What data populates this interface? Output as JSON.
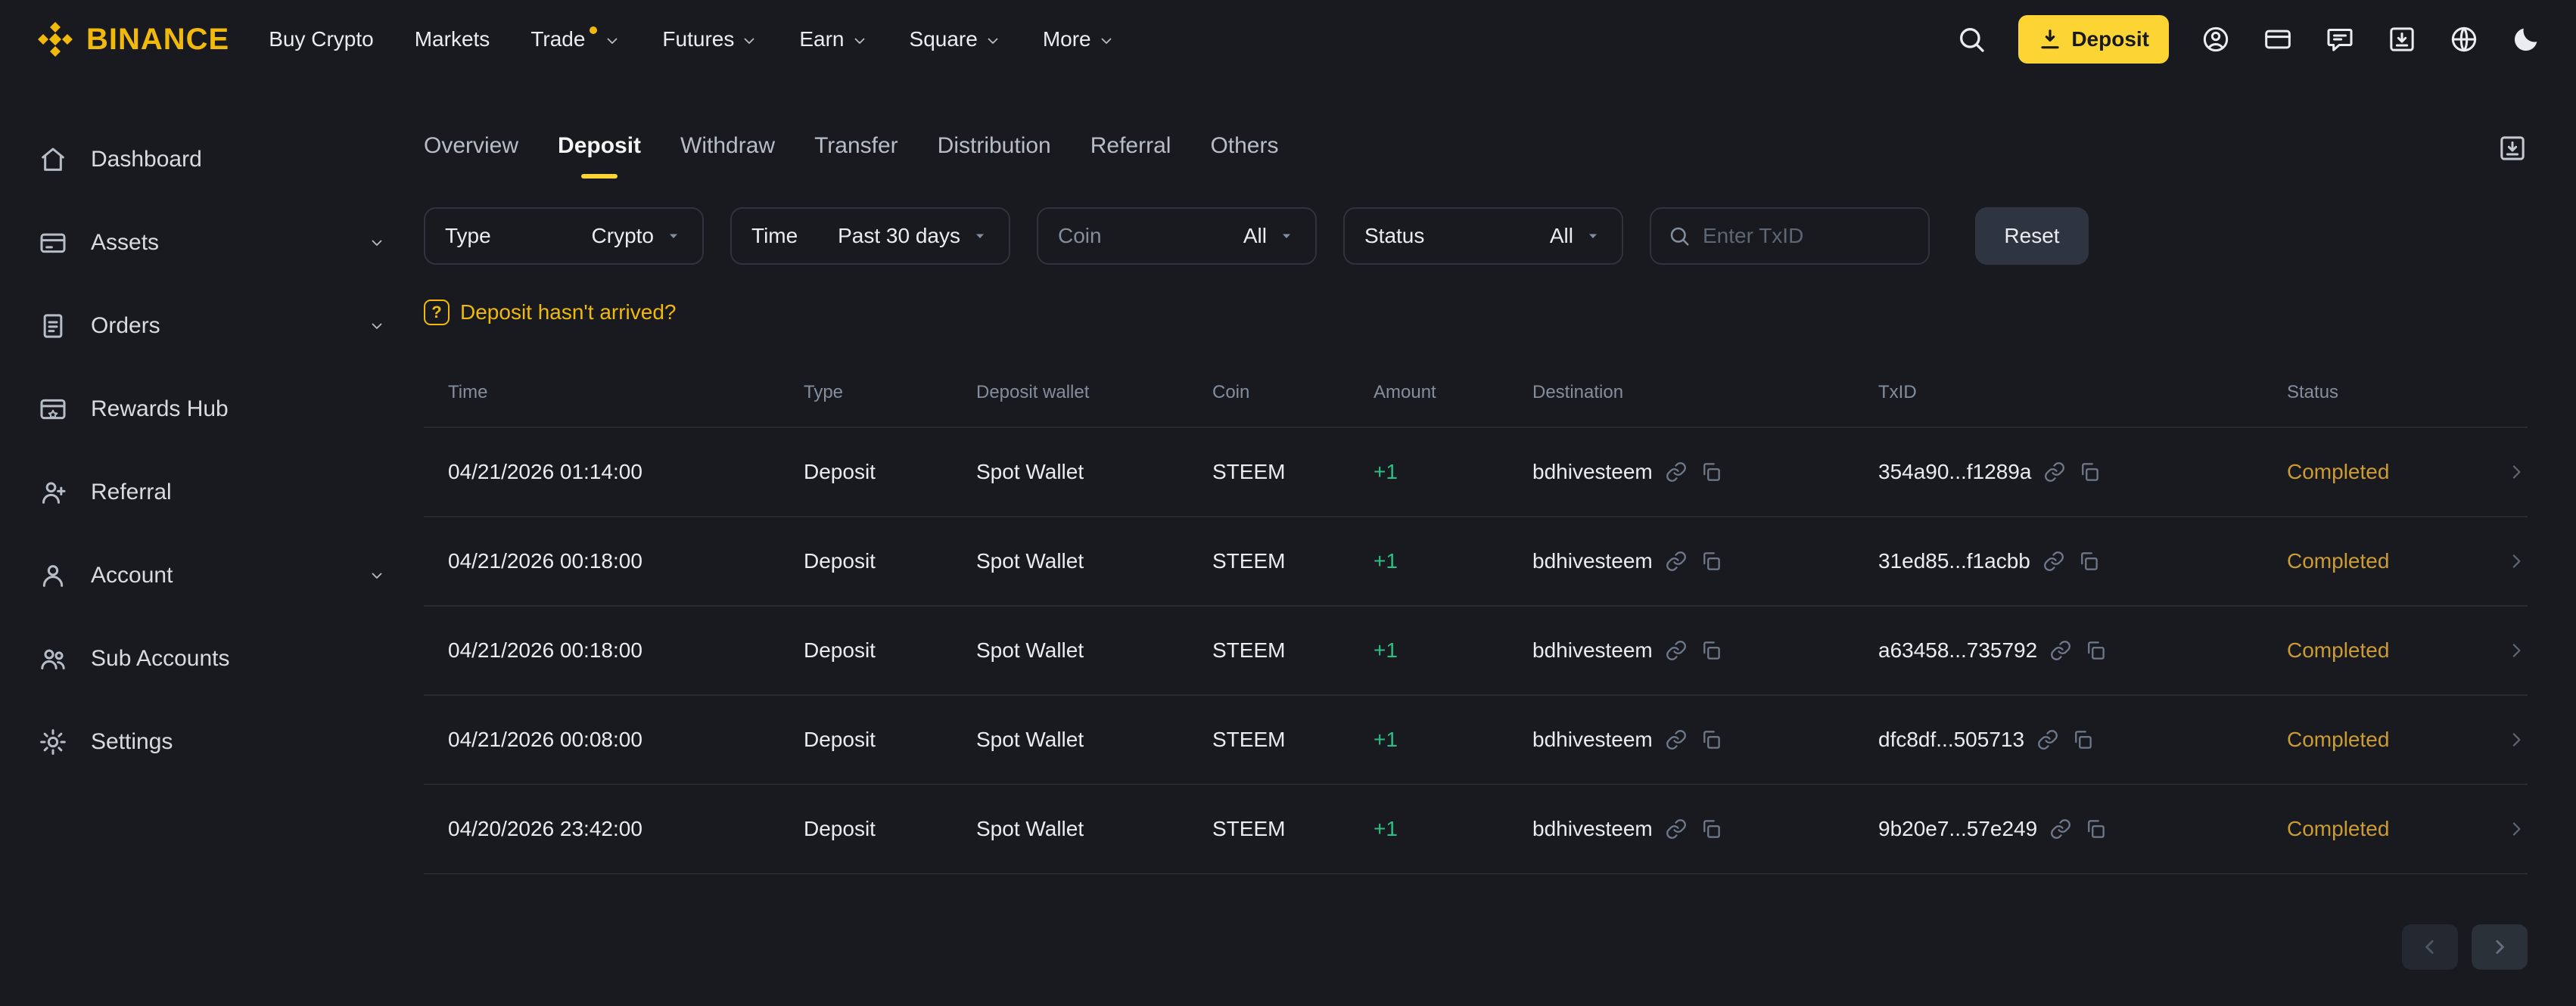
{
  "navbar": {
    "brand": "BINANCE",
    "menu": [
      {
        "label": "Buy Crypto",
        "dropdown": false,
        "dot": false
      },
      {
        "label": "Markets",
        "dropdown": false,
        "dot": false
      },
      {
        "label": "Trade",
        "dropdown": true,
        "dot": true
      },
      {
        "label": "Futures",
        "dropdown": true,
        "dot": false
      },
      {
        "label": "Earn",
        "dropdown": true,
        "dot": false
      },
      {
        "label": "Square",
        "dropdown": true,
        "dot": false
      },
      {
        "label": "More",
        "dropdown": true,
        "dot": false
      }
    ],
    "search_icon": "search-icon",
    "deposit_button": {
      "label": "Deposit",
      "icon": "deposit-arrow-icon"
    },
    "right_icons": [
      "user-icon",
      "wallet-icon",
      "support-chat-icon",
      "app-download-icon",
      "globe-icon",
      "theme-moon-icon"
    ]
  },
  "sidebar": {
    "items": [
      {
        "label": "Dashboard",
        "icon": "dashboard-icon",
        "expandable": false
      },
      {
        "label": "Assets",
        "icon": "assets-icon",
        "expandable": true
      },
      {
        "label": "Orders",
        "icon": "orders-icon",
        "expandable": true
      },
      {
        "label": "Rewards Hub",
        "icon": "rewards-hub-icon",
        "expandable": false
      },
      {
        "label": "Referral",
        "icon": "referral-icon",
        "expandable": false
      },
      {
        "label": "Account",
        "icon": "account-icon",
        "expandable": true
      },
      {
        "label": "Sub Accounts",
        "icon": "sub-accounts-icon",
        "expandable": false
      },
      {
        "label": "Settings",
        "icon": "settings-icon",
        "expandable": false
      }
    ]
  },
  "tabs": [
    {
      "label": "Overview",
      "active": false
    },
    {
      "label": "Deposit",
      "active": true
    },
    {
      "label": "Withdraw",
      "active": false
    },
    {
      "label": "Transfer",
      "active": false
    },
    {
      "label": "Distribution",
      "active": false
    },
    {
      "label": "Referral",
      "active": false
    },
    {
      "label": "Others",
      "active": false
    }
  ],
  "filters": {
    "type": {
      "label": "Type",
      "value": "Crypto"
    },
    "time": {
      "label": "Time",
      "value": "Past 30 days"
    },
    "coin": {
      "label": "Coin",
      "value": "All"
    },
    "status": {
      "label": "Status",
      "value": "All"
    },
    "txid_placeholder": "Enter TxID",
    "reset_label": "Reset"
  },
  "help_link": "Deposit hasn't arrived?",
  "help_icon_glyph": "?",
  "table": {
    "headers": [
      "Time",
      "Type",
      "Deposit wallet",
      "Coin",
      "Amount",
      "Destination",
      "TxID",
      "Status"
    ],
    "rows": [
      {
        "time": "04/21/2026 01:14:00",
        "type": "Deposit",
        "wallet": "Spot Wallet",
        "coin": "STEEM",
        "amount": "+1",
        "destination": "bdhivesteem",
        "txid": "354a90...f1289a",
        "status": "Completed"
      },
      {
        "time": "04/21/2026 00:18:00",
        "type": "Deposit",
        "wallet": "Spot Wallet",
        "coin": "STEEM",
        "amount": "+1",
        "destination": "bdhivesteem",
        "txid": "31ed85...f1acbb",
        "status": "Completed"
      },
      {
        "time": "04/21/2026 00:18:00",
        "type": "Deposit",
        "wallet": "Spot Wallet",
        "coin": "STEEM",
        "amount": "+1",
        "destination": "bdhivesteem",
        "txid": "a63458...735792",
        "status": "Completed"
      },
      {
        "time": "04/21/2026 00:08:00",
        "type": "Deposit",
        "wallet": "Spot Wallet",
        "coin": "STEEM",
        "amount": "+1",
        "destination": "bdhivesteem",
        "txid": "dfc8df...505713",
        "status": "Completed"
      },
      {
        "time": "04/20/2026 23:42:00",
        "type": "Deposit",
        "wallet": "Spot Wallet",
        "coin": "STEEM",
        "amount": "+1",
        "destination": "bdhivesteem",
        "txid": "9b20e7...57e249",
        "status": "Completed"
      }
    ]
  },
  "colors": {
    "background": "#181a20",
    "brand_yellow": "#f0b90b",
    "button_yellow": "#fcd535",
    "positive_green": "#2ebd85",
    "status_completed": "#cc9c33",
    "panel_border": "#2e333d",
    "text_primary": "#eaecef",
    "text_secondary": "#848e9c"
  }
}
